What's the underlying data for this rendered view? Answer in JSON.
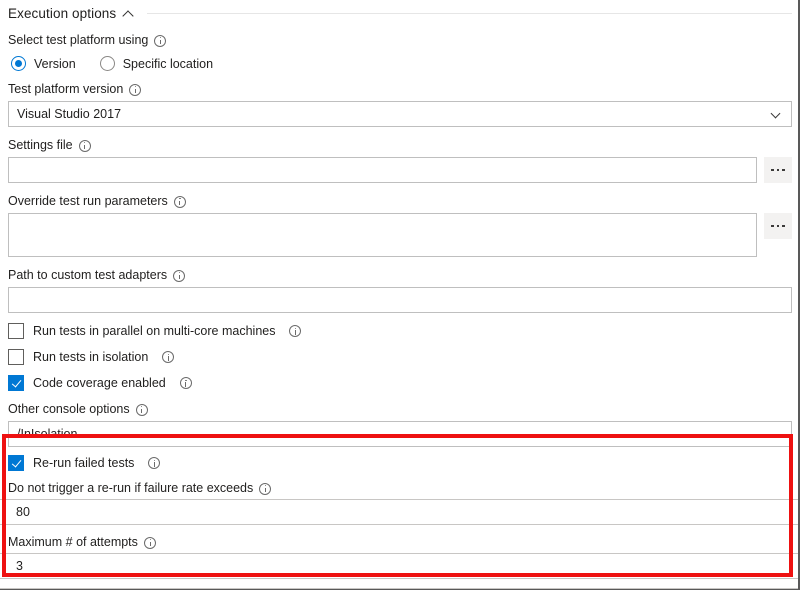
{
  "section": {
    "title": "Execution options",
    "collapse_icon": "chevron-up-icon"
  },
  "fields": {
    "platform_selector": {
      "label": "Select test platform using",
      "options": [
        {
          "label": "Version",
          "selected": true
        },
        {
          "label": "Specific location",
          "selected": false
        }
      ]
    },
    "test_platform_version": {
      "label": "Test platform version",
      "value": "Visual Studio 2017",
      "chevron": "chevron-down-icon"
    },
    "settings_file": {
      "label": "Settings file",
      "value": "",
      "placeholder": "",
      "browse_label": "..."
    },
    "override_test_run_parameters": {
      "label": "Override test run parameters",
      "value": "",
      "placeholder": "",
      "browse_label": "..."
    },
    "path_to_custom_test_adapters": {
      "label": "Path to custom test adapters",
      "value": "",
      "placeholder": ""
    },
    "run_tests_in_parallel": {
      "label": "Run tests in parallel on multi-core machines",
      "checked": false
    },
    "run_tests_in_isolation": {
      "label": "Run tests in isolation",
      "checked": false
    },
    "code_coverage_enabled": {
      "label": "Code coverage enabled",
      "checked": true
    },
    "other_console_options": {
      "label": "Other console options",
      "value": "/InIsolation"
    },
    "rerun_failed_tests": {
      "label": "Re-run failed tests",
      "checked": true
    },
    "failure_rate_threshold": {
      "label": "Do not trigger a re-run if failure rate exceeds",
      "value": "80"
    },
    "max_attempts": {
      "label": "Maximum # of attempts",
      "value": "3"
    }
  },
  "colors": {
    "accent": "#0078d4",
    "highlight": "#ee1111",
    "border": "#bfbfbf",
    "text": "#201f1e"
  }
}
